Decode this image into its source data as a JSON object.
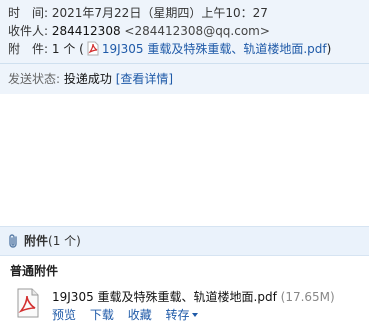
{
  "header": {
    "time_label": "时　间:",
    "time_value": "2021年7月22日（星期四）上午10：27",
    "recipient_label": "收件人:",
    "recipient_name": "284412308",
    "recipient_email": "<284412308@qq.com>",
    "attachment_label": "附　件:",
    "attachment_count": "1 个 (",
    "attachment_file": "19J305 重载及特殊重载、轨道楼地面.pdf",
    "attachment_close": ")",
    "status_label": "发送状态:",
    "status_value": "投递成功",
    "status_link": "[查看详情]"
  },
  "attachments": {
    "title": "附件",
    "count": "(1 个)",
    "section_title": "普通附件",
    "file_name": "19J305 重载及特殊重载、轨道楼地面.pdf",
    "file_size": "(17.65M)",
    "actions": {
      "preview": "预览",
      "download": "下载",
      "favorite": "收藏",
      "forward": "转存"
    }
  },
  "colors": {
    "link": "#1f5aa8",
    "header_bg": "#eef4fb",
    "pdf_red": "#d32f2f"
  },
  "icons": [
    "pdf-icon",
    "paperclip-icon",
    "chevron-down-icon"
  ]
}
